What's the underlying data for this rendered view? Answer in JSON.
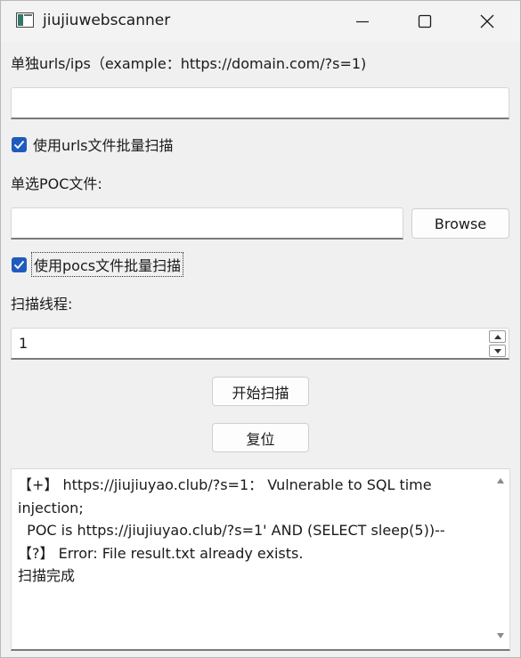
{
  "window": {
    "title": "jiujiuwebscanner",
    "icon": "app-window-icon",
    "controls": [
      "minimize-icon",
      "maximize-icon",
      "close-icon"
    ]
  },
  "url_section": {
    "label": "单独urls/ips（example：https://domain.com/?s=1)",
    "value": ""
  },
  "batch_urls": {
    "label": "使用urls文件批量扫描",
    "checked": true
  },
  "poc_section": {
    "label": "单选POC文件:",
    "value": "",
    "browse_label": "Browse"
  },
  "batch_pocs": {
    "label": "使用pocs文件批量扫描",
    "checked": true
  },
  "threads": {
    "label": "扫描线程:",
    "value": "1"
  },
  "actions": {
    "start_label": "开始扫描",
    "reset_label": "复位"
  },
  "output": {
    "lines": [
      "【+】 https://jiujiuyao.club/?s=1： Vulnerable to SQL time injection;",
      "  POC is https://jiujiuyao.club/?s=1' AND (SELECT sleep(5))--",
      "【?】 Error: File result.txt already exists.",
      "扫描完成"
    ]
  },
  "colors": {
    "accent": "#1f5bbf",
    "background": "#f0f0f0"
  }
}
